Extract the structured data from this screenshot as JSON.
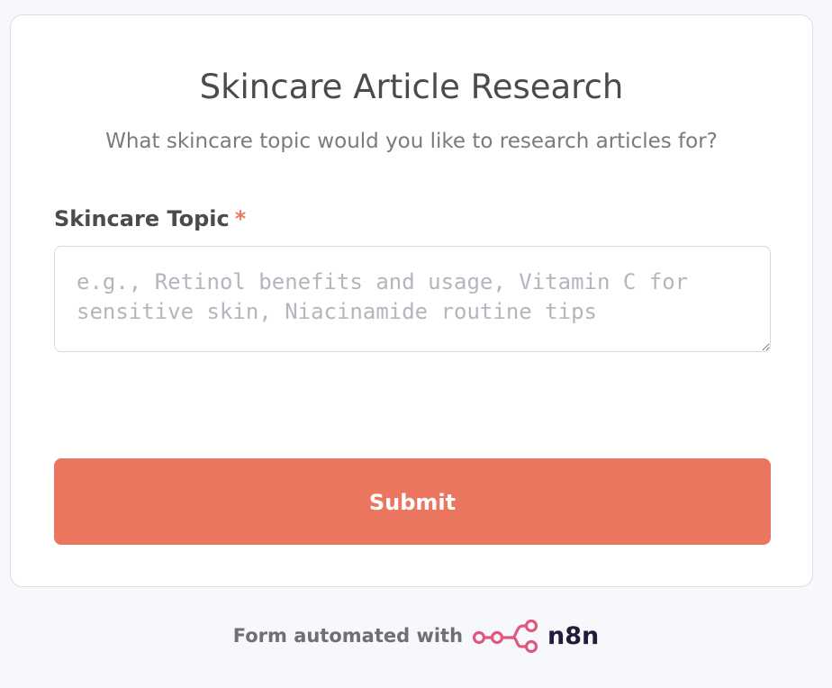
{
  "form": {
    "title": "Skincare Article Research",
    "subtitle": "What skincare topic would you like to research articles for?",
    "field_label": "Skincare Topic",
    "required_marker": "*",
    "field_value": "",
    "field_placeholder": "e.g., Retinol benefits and usage, Vitamin C for sensitive skin, Niacinamide routine tips",
    "submit_label": "Submit"
  },
  "footer": {
    "text": "Form automated with",
    "brand_name": "n8n",
    "brand_logo_icon": "n8n-logo-icon"
  },
  "colors": {
    "accent": "#eb7660",
    "brand_logo": "#e0587e",
    "background": "#f7f8fb"
  }
}
